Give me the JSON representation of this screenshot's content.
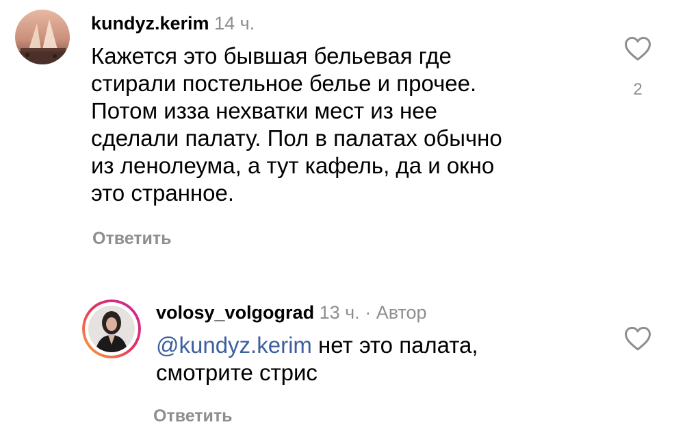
{
  "comments": [
    {
      "username": "kundyz.kerim",
      "time": "14 ч.",
      "text": "Кажется это бывшая бельевая где\nстирали постельное белье и прочее.\nПотом изза нехватки мест из нее\nсделали палату. Пол в палатах обычно\nиз ленолеума, а тут кафель, да и окно\nэто странное.",
      "reply_label": "Ответить",
      "likes": "2"
    },
    {
      "username": "volosy_volgograd",
      "time": "13 ч.",
      "separator": "·",
      "author_badge": "Автор",
      "mention": "@kundyz.kerim",
      "text_after_mention": " нет это палата,\nсмотрите стрис",
      "reply_label": "Ответить"
    }
  ],
  "icons": {
    "like": "heart-outline-icon"
  },
  "colors": {
    "username": "#000000",
    "secondary_text": "#8e8e8e",
    "mention": "#3d5fa0",
    "story_ring_start": "#f9a93b",
    "story_ring_end": "#c32aa3"
  }
}
